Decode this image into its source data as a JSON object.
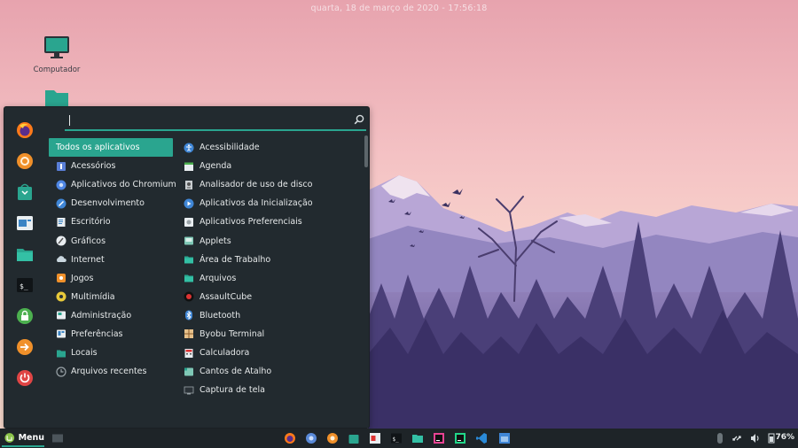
{
  "clock": {
    "text": "quarta, 18 de março de 2020 - 17:56:18"
  },
  "desktop": {
    "icons": [
      {
        "label": "Computador"
      },
      {
        "label": ""
      }
    ]
  },
  "menu": {
    "search": {
      "value": "",
      "placeholder": ""
    },
    "favorites": [
      "firefox-icon",
      "chromium-icon",
      "software-icon",
      "settings-icon",
      "files-icon",
      "terminal-icon",
      "lock-icon",
      "logout-icon",
      "shutdown-icon"
    ],
    "categories": [
      {
        "label": "Todos os aplicativos",
        "icon": "none"
      },
      {
        "label": "Acessórios",
        "icon": "accessories-icon"
      },
      {
        "label": "Aplicativos do Chromium",
        "icon": "chromium-apps-icon"
      },
      {
        "label": "Desenvolvimento",
        "icon": "development-icon"
      },
      {
        "label": "Escritório",
        "icon": "office-icon"
      },
      {
        "label": "Gráficos",
        "icon": "graphics-icon"
      },
      {
        "label": "Internet",
        "icon": "internet-icon"
      },
      {
        "label": "Jogos",
        "icon": "games-icon"
      },
      {
        "label": "Multimídia",
        "icon": "multimedia-icon"
      },
      {
        "label": "Administração",
        "icon": "administration-icon"
      },
      {
        "label": "Preferências",
        "icon": "preferences-icon"
      },
      {
        "label": "Locais",
        "icon": "places-icon"
      },
      {
        "label": "Arquivos recentes",
        "icon": "recent-files-icon"
      }
    ],
    "apps": [
      {
        "label": "Acessibilidade"
      },
      {
        "label": "Agenda"
      },
      {
        "label": "Analisador de uso de disco"
      },
      {
        "label": "Aplicativos da Inicialização"
      },
      {
        "label": "Aplicativos Preferenciais"
      },
      {
        "label": "Applets"
      },
      {
        "label": "Área de Trabalho"
      },
      {
        "label": "Arquivos"
      },
      {
        "label": "AssaultCube"
      },
      {
        "label": "Bluetooth"
      },
      {
        "label": "Byobu Terminal"
      },
      {
        "label": "Calculadora"
      },
      {
        "label": "Cantos de Atalho"
      },
      {
        "label": "Captura de tela"
      }
    ]
  },
  "panel": {
    "menu_label": "Menu",
    "battery": "76%"
  },
  "colors": {
    "accent": "#2aa58f",
    "menu_bg": "#222a2f",
    "panel_bg": "#1e2428"
  }
}
